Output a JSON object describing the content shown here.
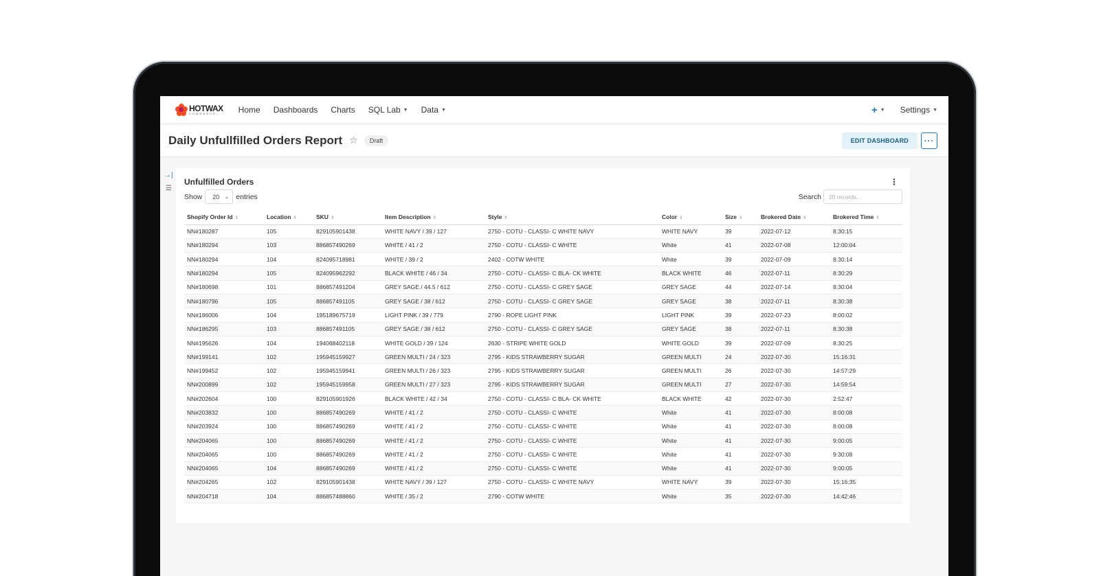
{
  "nav": {
    "logo_word": "HOTWAX",
    "logo_sub": "COMMERCE",
    "items": [
      "Home",
      "Dashboards",
      "Charts",
      "SQL Lab",
      "Data"
    ],
    "plus_label": "+",
    "settings_label": "Settings"
  },
  "header": {
    "title": "Daily Unfullfilled Orders Report",
    "badge": "Draft",
    "edit_label": "EDIT DASHBOARD",
    "more_label": "···"
  },
  "card": {
    "title": "Unfulfilled Orders",
    "show_label": "Show",
    "show_value": "20",
    "entries_label": "entries",
    "search_label": "Search",
    "search_placeholder": "20 records..."
  },
  "table": {
    "columns": [
      "Shopify Order Id",
      "Location",
      "SKU",
      "Item Description",
      "Style",
      "Color",
      "Size",
      "Brokered Date",
      "Brokered Time"
    ],
    "rows": [
      [
        "NN#180287",
        "105",
        "829105901438",
        "WHITE NAVY / 39 / 127",
        "2750 - COTU - CLASSI- C WHITE NAVY",
        "WHITE NAVY",
        "39",
        "2022-07-12",
        "8:30:15"
      ],
      [
        "NN#180294",
        "103",
        "886857490269",
        "WHITE / 41 / 2",
        "2750 - COTU - CLASSI- C WHITE",
        "White",
        "41",
        "2022-07-08",
        "12:00:04"
      ],
      [
        "NN#180294",
        "104",
        "824095718981",
        "WHITE / 39 / 2",
        "2402 - COTW WHITE",
        "White",
        "39",
        "2022-07-09",
        "8:30:14"
      ],
      [
        "NN#180294",
        "105",
        "824095962292",
        "BLACK WHITE / 46 / 34",
        "2750 - COTU - CLASSI- C BLA- CK WHITE",
        "BLACK WHITE",
        "46",
        "2022-07-11",
        "8:30:29"
      ],
      [
        "NN#180698",
        "101",
        "886857491204",
        "GREY SAGE / 44.5 / 612",
        "2750 - COTU - CLASSI- C GREY SAGE",
        "GREY SAGE",
        "44",
        "2022-07-14",
        "8:30:04"
      ],
      [
        "NN#180796",
        "105",
        "886857491105",
        "GREY SAGE / 38 / 612",
        "2750 - COTU - CLASSI- C GREY SAGE",
        "GREY SAGE",
        "38",
        "2022-07-11",
        "8:30:38"
      ],
      [
        "NN#186006",
        "104",
        "195189675719",
        "LIGHT PINK / 39 / 779",
        "2790 - ROPE LIGHT PINK",
        "LIGHT PINK",
        "39",
        "2022-07-23",
        "8:00:02"
      ],
      [
        "NN#186295",
        "103",
        "886857491105",
        "GREY SAGE / 38 / 612",
        "2750 - COTU - CLASSI- C GREY SAGE",
        "GREY SAGE",
        "38",
        "2022-07-11",
        "8:30:38"
      ],
      [
        "NN#195626",
        "104",
        "194068402118",
        "WHITE GOLD / 39 / 124",
        "2630 - STRIPE WHITE GOLD",
        "WHITE GOLD",
        "39",
        "2022-07-09",
        "8:30:25"
      ],
      [
        "NN#199141",
        "102",
        "195945159927",
        "GREEN MULTI / 24 / 323",
        "2795 - KIDS STRAWBERRY SUGAR",
        "GREEN MULTI",
        "24",
        "2022-07-30",
        "15:16:31"
      ],
      [
        "NN#199452",
        "102",
        "195945159941",
        "GREEN MULTI / 26 / 323",
        "2795 - KIDS STRAWBERRY SUGAR",
        "GREEN MULTI",
        "26",
        "2022-07-30",
        "14:57:29"
      ],
      [
        "NN#200899",
        "102",
        "195945159958",
        "GREEN MULTI / 27 / 323",
        "2795 - KIDS STRAWBERRY SUGAR",
        "GREEN MULTI",
        "27",
        "2022-07-30",
        "14:59:54"
      ],
      [
        "NN#202604",
        "100",
        "829105901926",
        "BLACK WHITE / 42 / 34",
        "2750 - COTU - CLASSI- C BLA- CK WHITE",
        "BLACK WHITE",
        "42",
        "2022-07-30",
        "2:52:47"
      ],
      [
        "NN#203832",
        "100",
        "886857490269",
        "WHITE / 41 / 2",
        "2750 - COTU - CLASSI- C WHITE",
        "White",
        "41",
        "2022-07-30",
        "8:00:08"
      ],
      [
        "NN#203924",
        "100",
        "886857490269",
        "WHITE / 41 / 2",
        "2750 - COTU - CLASSI- C WHITE",
        "White",
        "41",
        "2022-07-30",
        "8:00:08"
      ],
      [
        "NN#204065",
        "100",
        "886857490269",
        "WHITE / 41 / 2",
        "2750 - COTU - CLASSI- C WHITE",
        "White",
        "41",
        "2022-07-30",
        "9:00:05"
      ],
      [
        "NN#204065",
        "100",
        "886857490269",
        "WHITE / 41 / 2",
        "2750 - COTU - CLASSI- C WHITE",
        "White",
        "41",
        "2022-07-30",
        "9:30:08"
      ],
      [
        "NN#204065",
        "104",
        "886857490269",
        "WHITE / 41 / 2",
        "2750 - COTU - CLASSI- C WHITE",
        "White",
        "41",
        "2022-07-30",
        "9:00:05"
      ],
      [
        "NN#204265",
        "102",
        "829105901438",
        "WHITE NAVY / 39 / 127",
        "2750 - COTU - CLASSI- C WHITE NAVY",
        "WHITE NAVY",
        "39",
        "2022-07-30",
        "15:16:35"
      ],
      [
        "NN#204718",
        "104",
        "886857488860",
        "WHITE / 35 / 2",
        "2790 - COTW WHITE",
        "White",
        "35",
        "2022-07-30",
        "14:42:46"
      ]
    ]
  },
  "colors": {
    "accent": "#1f7ab8",
    "logo": "#f04e23",
    "edit_button_bg": "#e3f1f8"
  },
  "icons": {
    "logo": "flower-logo-icon",
    "star": "star-icon",
    "more": "more-horizontal-icon",
    "kebab": "kebab-vertical-icon",
    "collapse": "collapse-arrow-icon",
    "filter": "filter-icon",
    "sort": "sort-icon",
    "caret": "caret-down-icon"
  }
}
